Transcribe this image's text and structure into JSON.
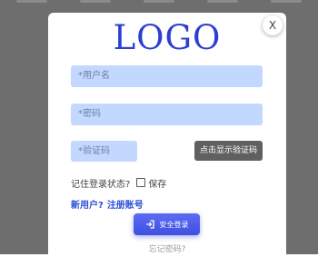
{
  "modal": {
    "close_label": "X",
    "logo_text": "LOGO"
  },
  "form": {
    "username_placeholder": "*用户名",
    "password_placeholder": "*密码",
    "captcha_placeholder": "*验证码",
    "captcha_button": "点击显示验证码",
    "remember_question": "记住登录状态?",
    "remember_label": "保存",
    "remember_checked": false,
    "new_user_text": "新用户?",
    "register_link": "注册账号",
    "login_button": "安全登录",
    "forgot_link": "忘记密码?"
  },
  "colors": {
    "logo": "#2c3fd0",
    "input_bg": "#c3d8ff",
    "captcha_button_bg": "#606060",
    "login_button": "#4a5ae8",
    "link": "#2a4fd6",
    "overlay": "#6e6e6e"
  },
  "icons": {
    "close": "close-icon",
    "login": "login-arrow-icon"
  }
}
